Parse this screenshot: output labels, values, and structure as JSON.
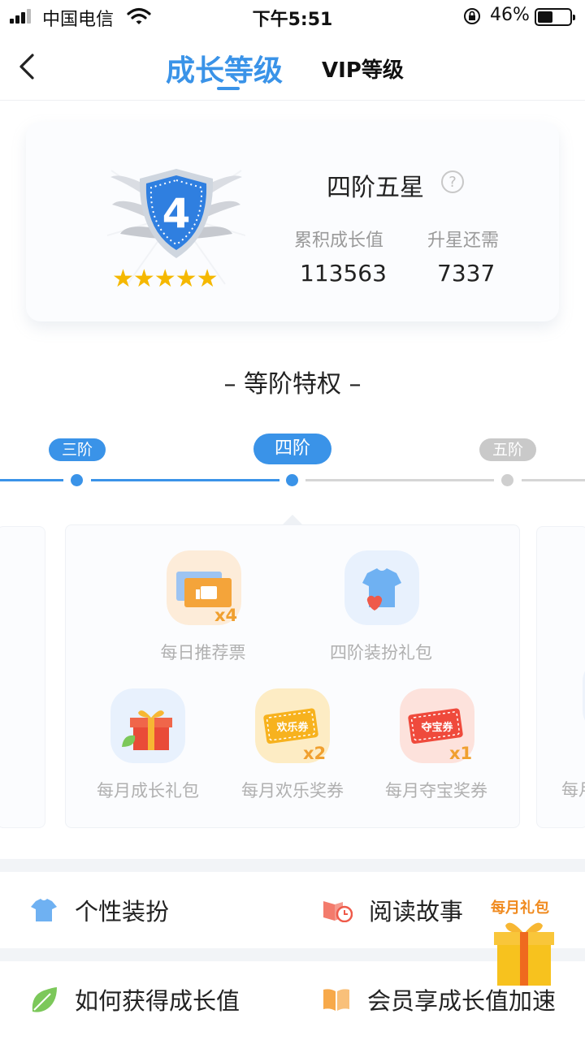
{
  "status_bar": {
    "carrier": "中国电信",
    "time": "下午5:51",
    "battery_percent": "46%"
  },
  "nav": {
    "tab_growth": "成长等级",
    "tab_vip": "VIP等级"
  },
  "level_card": {
    "badge_number": "4",
    "stars": "★★★★★",
    "level_name": "四阶五星",
    "help": "?",
    "accumulated_label": "累积成长值",
    "accumulated_value": "113563",
    "needed_label": "升星还需",
    "needed_value": "7337"
  },
  "privileges": {
    "title": "– 等阶特权 –",
    "tiers": {
      "prev": "三阶",
      "current": "四阶",
      "next": "五阶"
    },
    "perks": [
      {
        "label": "每日推荐票",
        "multiplier": "x4"
      },
      {
        "label": "四阶装扮礼包"
      },
      {
        "label": "每月成长礼包"
      },
      {
        "label": "每月欢乐奖券",
        "multiplier": "x2",
        "ticket": "欢乐券"
      },
      {
        "label": "每月夺宝奖券",
        "multiplier": "x1",
        "ticket": "夺宝券"
      }
    ],
    "peek_label": "每月"
  },
  "menu": {
    "dressup": "个性装扮",
    "reading": "阅读故事",
    "how_to_grow": "如何获得成长值",
    "speedup": "会员享成长值加速",
    "monthly_gift": "每月礼包"
  },
  "colors": {
    "accent": "#3a93e8",
    "inactive": "#c9c9c9",
    "star": "#f5b800",
    "orange": "#f0a030"
  }
}
